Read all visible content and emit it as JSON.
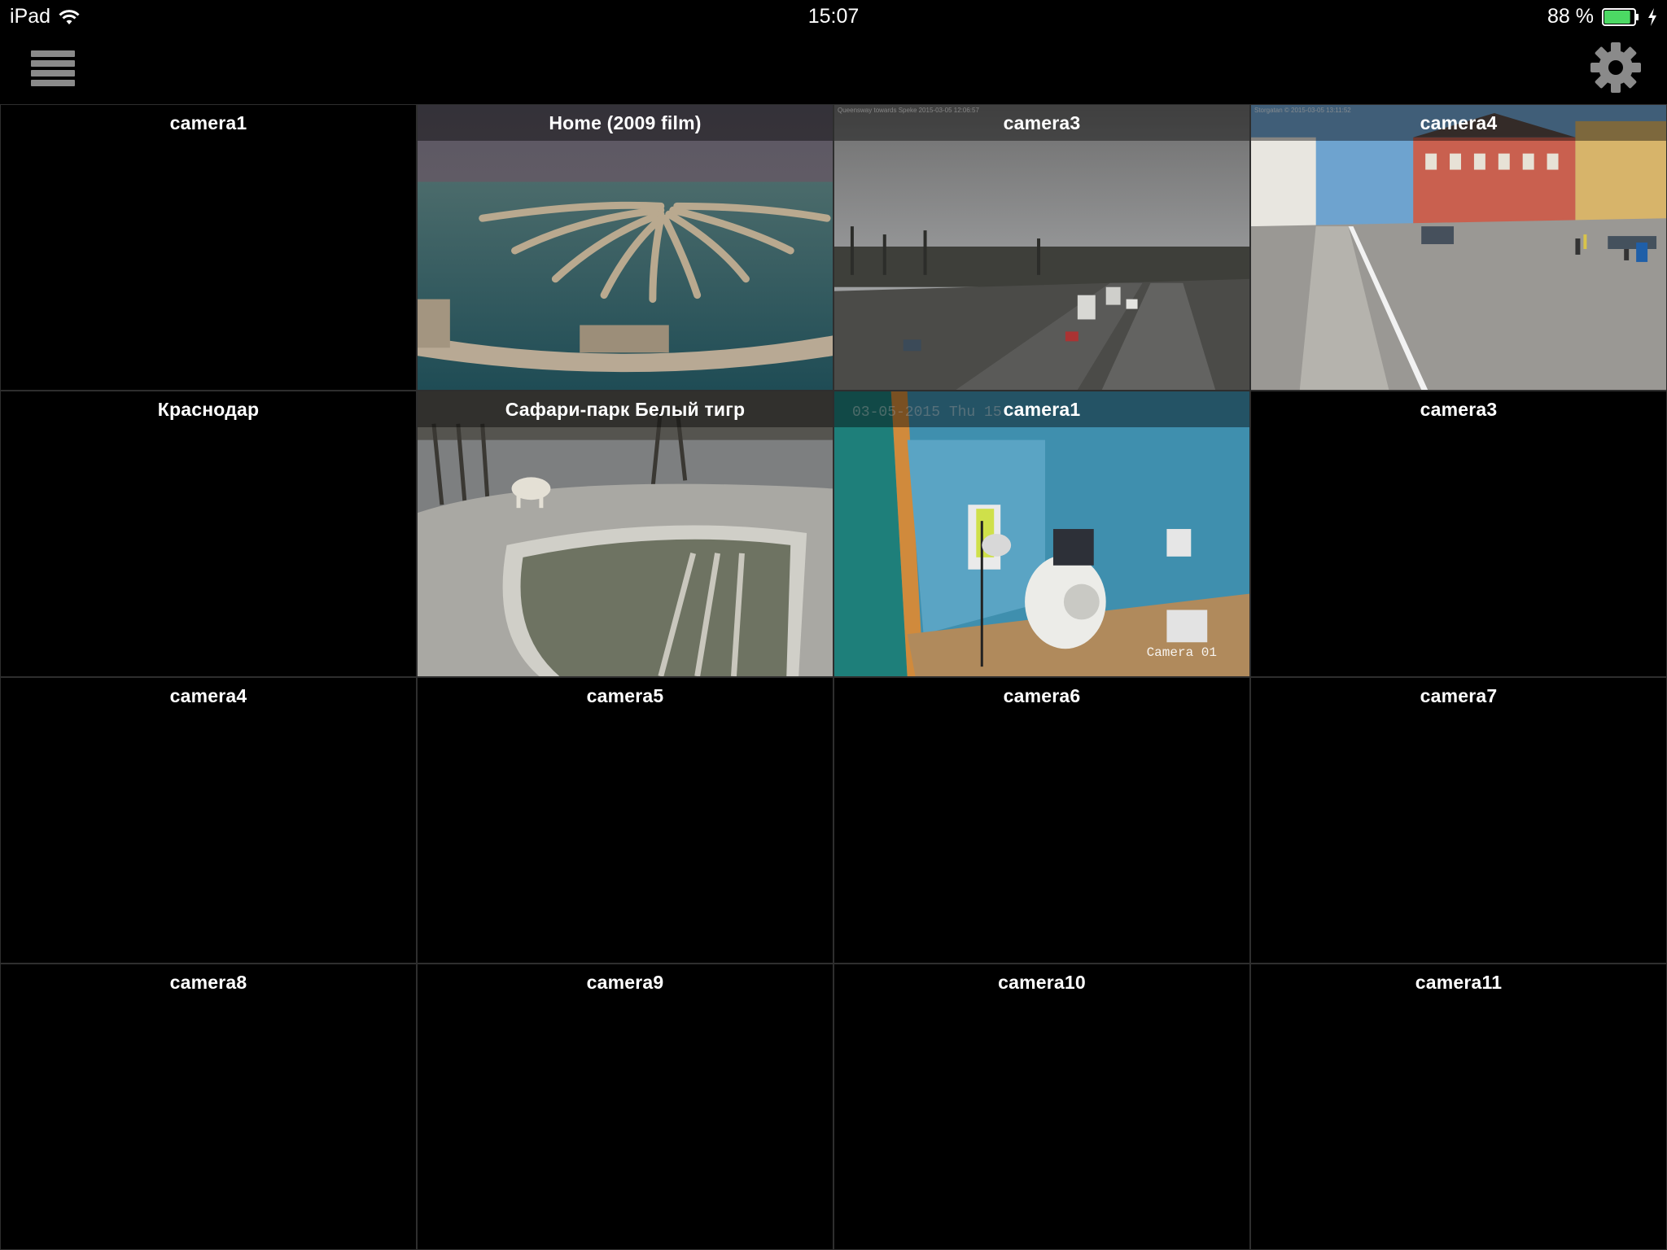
{
  "status_bar": {
    "device": "iPad",
    "time": "15:07",
    "battery_percent": "88 %",
    "battery_level": 0.88
  },
  "toolbar": {
    "menu_icon": "hamburger-menu-icon",
    "settings_icon": "gear-icon"
  },
  "colors": {
    "background": "#000000",
    "tile_border": "#2e2e2e",
    "toolbar_icon": "#8a8a8a",
    "battery_fill": "#4cd964"
  },
  "cameras": [
    {
      "title": "camera1",
      "feed": "none"
    },
    {
      "title": "Home (2009 film)",
      "feed": "aerial-palm-island"
    },
    {
      "title": "camera3",
      "feed": "highway",
      "osd_top": "Queensway towards Speke 2015-03-05 12:06:57"
    },
    {
      "title": "camera4",
      "feed": "street",
      "osd_top": "Storgatan © 2015-03-05 13:11:52"
    },
    {
      "title": "Краснодар",
      "feed": "none"
    },
    {
      "title": "Сафари-парк Белый тигр",
      "feed": "white-tiger-enclosure"
    },
    {
      "title": "camera1",
      "feed": "office",
      "osd_date": "03-05-2015 Thu 15",
      "osd_cam": "Camera 01"
    },
    {
      "title": "camera3",
      "feed": "none"
    },
    {
      "title": "camera4",
      "feed": "none"
    },
    {
      "title": "camera5",
      "feed": "none"
    },
    {
      "title": "camera6",
      "feed": "none"
    },
    {
      "title": "camera7",
      "feed": "none"
    },
    {
      "title": "camera8",
      "feed": "none"
    },
    {
      "title": "camera9",
      "feed": "none"
    },
    {
      "title": "camera10",
      "feed": "none"
    },
    {
      "title": "camera11",
      "feed": "none"
    }
  ]
}
